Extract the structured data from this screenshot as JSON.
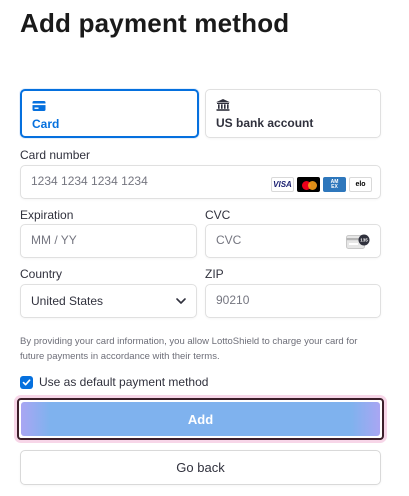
{
  "page": {
    "title": "Add payment method"
  },
  "tabs": [
    {
      "label": "Card",
      "icon": "card-icon",
      "active": true
    },
    {
      "label": "US bank account",
      "icon": "bank-icon",
      "active": false
    }
  ],
  "card_number": {
    "label": "Card number",
    "placeholder": "1234 1234 1234 1234",
    "value": "",
    "brands": [
      "VISA",
      "Mastercard",
      "AMERICAN EXPRESS",
      "elo"
    ]
  },
  "expiration": {
    "label": "Expiration",
    "placeholder": "MM / YY",
    "value": ""
  },
  "cvc": {
    "label": "CVC",
    "placeholder": "CVC",
    "value": "",
    "icon": "cvc-card-icon",
    "icon_text": "135"
  },
  "country": {
    "label": "Country",
    "value": "United States"
  },
  "zip": {
    "label": "ZIP",
    "placeholder": "90210",
    "value": ""
  },
  "terms": "By providing your card information, you allow LottoShield to charge your card for future payments in accordance with their terms.",
  "default_method": {
    "label": "Use as default payment method",
    "checked": true
  },
  "buttons": {
    "add": "Add",
    "back": "Go back"
  },
  "colors": {
    "accent": "#0570de",
    "add_button": "#7fb2ee",
    "focus_ring": "#3c1f2a"
  }
}
